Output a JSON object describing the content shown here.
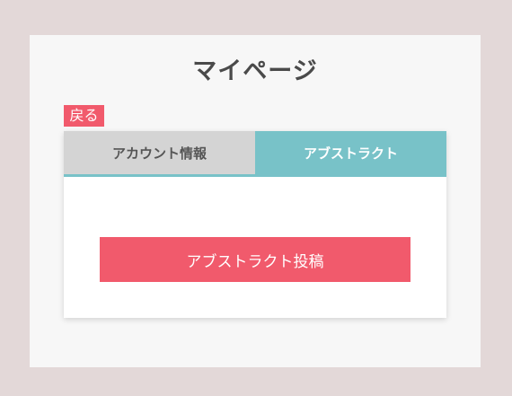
{
  "page": {
    "title": "マイページ"
  },
  "back": {
    "label": "戻る"
  },
  "tabs": [
    {
      "label": "アカウント情報",
      "active": false
    },
    {
      "label": "アブストラクト",
      "active": true
    }
  ],
  "actions": {
    "post_abstract_label": "アブストラクト投稿"
  },
  "colors": {
    "background": "#e3d8d8",
    "panel": "#f7f7f7",
    "accent_red": "#f15a6c",
    "accent_teal": "#78c2c8",
    "inactive_tab": "#d4d4d4",
    "title_text": "#4a4a4a"
  }
}
